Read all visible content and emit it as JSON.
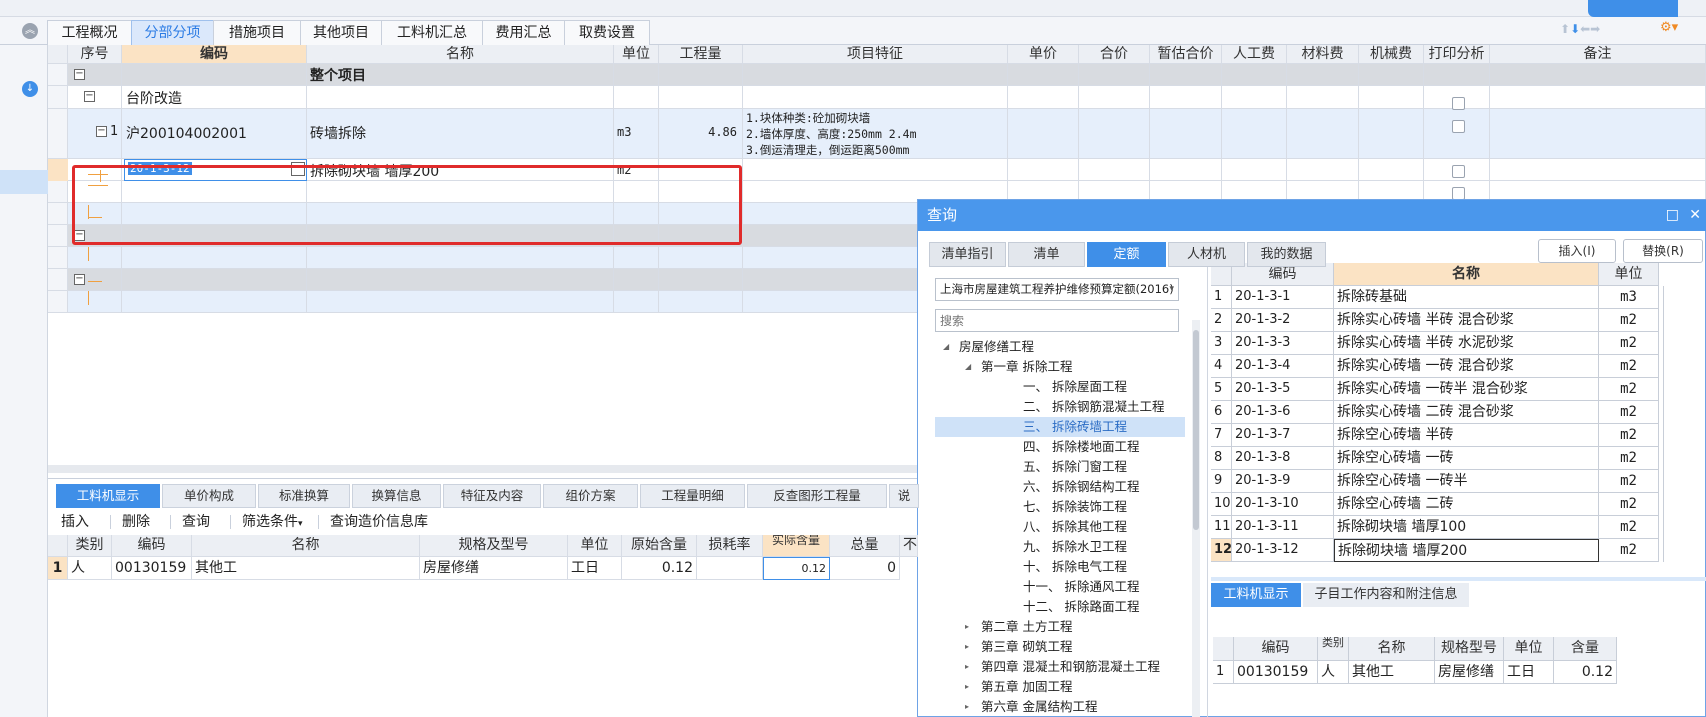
{
  "main_tabs": [
    "工程概况",
    "分部分项",
    "措施项目",
    "其他项目",
    "工料机汇总",
    "费用汇总",
    "取费设置"
  ],
  "active_tab": "分部分项",
  "grid": {
    "headers": [
      "序号",
      "编码",
      "名称",
      "单位",
      "工程量",
      "项目特征",
      "单价",
      "合价",
      "暂估合价",
      "人工费",
      "材料费",
      "机械费",
      "打印分析",
      "备注"
    ],
    "row_whole": "整个项目",
    "row_section": "台阶改造",
    "row_item": {
      "seq": "1",
      "code": "沪200104002001",
      "name": "砖墙拆除",
      "unit": "m3",
      "qty": "4.86",
      "features": [
        "1.块体种类:砼加砌块墙",
        "2.墙体厚度、高度:250mm  2.4m",
        "3.倒运清理走，倒运距离500mm"
      ]
    },
    "row_sub": {
      "code": "20-1-3-12",
      "name": "拆除砌块墙 墙厚200",
      "unit": "m2"
    },
    "expand_minus": "−",
    "ellipsis": "···"
  },
  "bottom": {
    "tabs": [
      "工料机显示",
      "单价构成",
      "标准换算",
      "换算信息",
      "特征及内容",
      "组价方案",
      "工程量明细",
      "反查图形工程量",
      "说"
    ],
    "toolbar": [
      "插入",
      "删除",
      "查询",
      "筛选条件",
      "查询造价信息库"
    ],
    "dropdown_arrow": "▾",
    "headers": [
      "类别",
      "编码",
      "名称",
      "规格及型号",
      "单位",
      "原始含量",
      "损耗率",
      "实际含量",
      "总量",
      "不"
    ],
    "rows": [
      {
        "idx": "1",
        "cat": "人",
        "code": "00130159",
        "name": "其他工",
        "spec": "房屋修缮",
        "unit": "工日",
        "orig": "0.12",
        "loss": "",
        "actual": "0.12",
        "total": "0"
      }
    ]
  },
  "dialog": {
    "title": "查询",
    "tabs": [
      "清单指引",
      "清单",
      "定额",
      "人材机",
      "我的数据"
    ],
    "active_tab": "定额",
    "insert_btn": "插入(I)",
    "replace_btn": "替换(R)",
    "quota_select": "上海市房屋建筑工程养护维修预算定额(2016)",
    "search_placeholder": "搜索",
    "tree": [
      {
        "label": "房屋修缮工程",
        "level": 0,
        "arrow": "◢"
      },
      {
        "label": "第一章 拆除工程",
        "level": 1,
        "arrow": "◢"
      },
      {
        "label": "一、 拆除屋面工程",
        "level": 2,
        "arrow": ""
      },
      {
        "label": "二、 拆除钢筋混凝土工程",
        "level": 2,
        "arrow": ""
      },
      {
        "label": "三、 拆除砖墙工程",
        "level": 2,
        "arrow": ""
      },
      {
        "label": "四、 拆除楼地面工程",
        "level": 2,
        "arrow": ""
      },
      {
        "label": "五、 拆除门窗工程",
        "level": 2,
        "arrow": ""
      },
      {
        "label": "六、 拆除钢结构工程",
        "level": 2,
        "arrow": ""
      },
      {
        "label": "七、 拆除装饰工程",
        "level": 2,
        "arrow": ""
      },
      {
        "label": "八、 拆除其他工程",
        "level": 2,
        "arrow": ""
      },
      {
        "label": "九、 拆除水卫工程",
        "level": 2,
        "arrow": ""
      },
      {
        "label": "十、 拆除电气工程",
        "level": 2,
        "arrow": ""
      },
      {
        "label": "十一、 拆除通风工程",
        "level": 2,
        "arrow": ""
      },
      {
        "label": "十二、 拆除路面工程",
        "level": 2,
        "arrow": ""
      },
      {
        "label": "第二章 土方工程",
        "level": 1,
        "arrow": "▸"
      },
      {
        "label": "第三章 砌筑工程",
        "level": 1,
        "arrow": "▸"
      },
      {
        "label": "第四章 混凝土和钢筋混凝土工程",
        "level": 1,
        "arrow": "▸"
      },
      {
        "label": "第五章 加固工程",
        "level": 1,
        "arrow": "▸"
      },
      {
        "label": "第六章 金属结构工程",
        "level": 1,
        "arrow": "▸"
      }
    ],
    "tree_selected": 4,
    "list_headers": [
      "编码",
      "名称",
      "单位"
    ],
    "list": [
      {
        "idx": "1",
        "code": "20-1-3-1",
        "name": "拆除砖基础",
        "unit": "m3"
      },
      {
        "idx": "2",
        "code": "20-1-3-2",
        "name": "拆除实心砖墙 半砖 混合砂浆",
        "unit": "m2"
      },
      {
        "idx": "3",
        "code": "20-1-3-3",
        "name": "拆除实心砖墙 半砖 水泥砂浆",
        "unit": "m2"
      },
      {
        "idx": "4",
        "code": "20-1-3-4",
        "name": "拆除实心砖墙 一砖 混合砂浆",
        "unit": "m2"
      },
      {
        "idx": "5",
        "code": "20-1-3-5",
        "name": "拆除实心砖墙 一砖半 混合砂浆",
        "unit": "m2"
      },
      {
        "idx": "6",
        "code": "20-1-3-6",
        "name": "拆除实心砖墙 二砖 混合砂浆",
        "unit": "m2"
      },
      {
        "idx": "7",
        "code": "20-1-3-7",
        "name": "拆除空心砖墙 半砖",
        "unit": "m2"
      },
      {
        "idx": "8",
        "code": "20-1-3-8",
        "name": "拆除空心砖墙 一砖",
        "unit": "m2"
      },
      {
        "idx": "9",
        "code": "20-1-3-9",
        "name": "拆除空心砖墙 一砖半",
        "unit": "m2"
      },
      {
        "idx": "10",
        "code": "20-1-3-10",
        "name": "拆除空心砖墙 二砖",
        "unit": "m2"
      },
      {
        "idx": "11",
        "code": "20-1-3-11",
        "name": "拆除砌块墙 墙厚100",
        "unit": "m2"
      },
      {
        "idx": "12",
        "code": "20-1-3-12",
        "name": "拆除砌块墙 墙厚200",
        "unit": "m2"
      }
    ],
    "list_selected": 11,
    "bottom_tabs": [
      "工料机显示",
      "子目工作内容和附注信息"
    ],
    "bottom_headers": [
      "编码",
      "类别",
      "名称",
      "规格型号",
      "单位",
      "含量"
    ],
    "bottom_rows": [
      {
        "idx": "1",
        "code": "00130159",
        "cat": "人",
        "name": "其他工",
        "spec": "房屋修缮",
        "unit": "工日",
        "qty": "0.12"
      }
    ],
    "maximize": "□",
    "close": "✕"
  },
  "colors": {
    "accent": "#3f8fe8",
    "selected_row": "#dbe8fb",
    "highlight_box": "#e02b2b"
  }
}
